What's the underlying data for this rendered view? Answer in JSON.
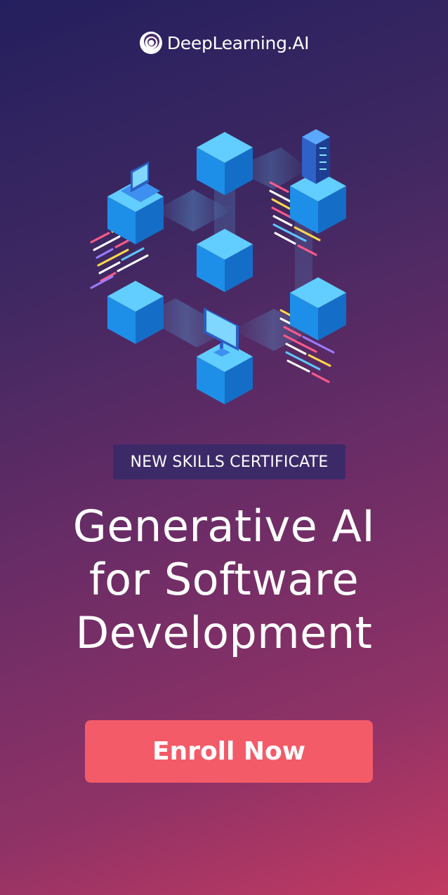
{
  "brand": {
    "name": "DeepLearning.AI",
    "logo_icon": "deeplearning-swirl-icon"
  },
  "badge": {
    "label": "NEW SKILLS CERTIFICATE"
  },
  "headline": {
    "lines": [
      "Generative AI",
      "for Software",
      "Development"
    ]
  },
  "cta": {
    "label": "Enroll Now"
  },
  "colors": {
    "background_top": "#241f5e",
    "background_bottom": "#c23a62",
    "badge_bg": "#3c2a68",
    "cta_bg": "#f45b68",
    "cube_top": "#5cc8ff",
    "cube_left": "#1f8ee6",
    "cube_right": "#1670c9"
  },
  "illustration": {
    "description_icon": "isometric-cube-network-illustration"
  }
}
